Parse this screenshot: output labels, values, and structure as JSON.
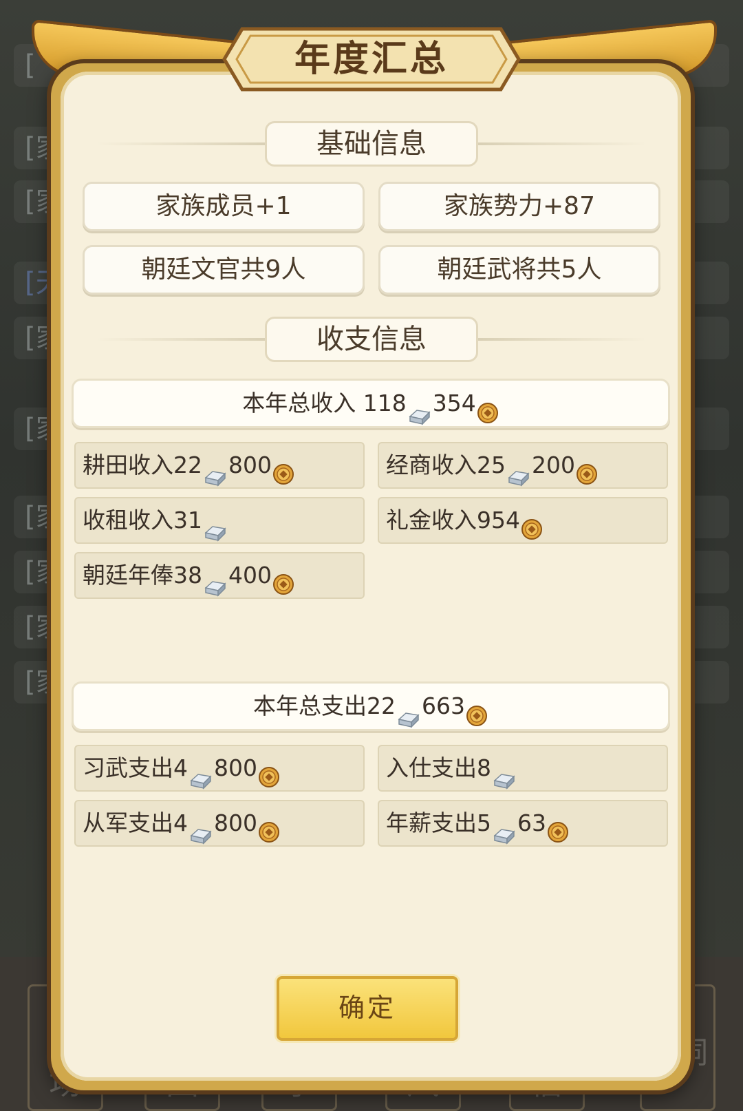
{
  "modal": {
    "title": "年度汇总",
    "sections": {
      "basic": "基础信息",
      "finance": "收支信息"
    },
    "basic_info": [
      "家族成员+1",
      "家族势力+87",
      "朝廷文官共9人",
      "朝廷武将共5人"
    ],
    "income_total": {
      "label": "本年总收入 ",
      "silver": "118",
      "copper": "354"
    },
    "income_items": [
      {
        "label": "耕田收入",
        "silver": "22",
        "copper": "800"
      },
      {
        "label": "经商收入",
        "silver": "25",
        "copper": "200"
      },
      {
        "label": "收租收入",
        "silver": "31",
        "copper": ""
      },
      {
        "label": "礼金收入",
        "silver": "",
        "copper": "954"
      },
      {
        "label": "朝廷年俸",
        "silver": "38",
        "copper": "400"
      }
    ],
    "expense_total": {
      "label": "本年总支出",
      "silver": "22",
      "copper": "663"
    },
    "expense_items": [
      {
        "label": "习武支出",
        "silver": "4",
        "copper": "800"
      },
      {
        "label": "入仕支出",
        "silver": "8",
        "copper": ""
      },
      {
        "label": "从军支出",
        "silver": "4",
        "copper": "800"
      },
      {
        "label": "年薪支出",
        "silver": "5",
        "copper": "63"
      }
    ],
    "confirm_label": "确定"
  },
  "background": {
    "rows": [
      "[",
      "[家",
      "[家",
      "[天",
      "[家",
      "[家",
      "[家",
      "[家",
      "[家",
      "[家"
    ],
    "tabs": [
      "场",
      "园",
      "事",
      "风",
      "信",
      "宗祠"
    ]
  },
  "colors": {
    "frame_gold": "#d0a84b",
    "panel": "#f7f0dc",
    "confirm": "#f1c73d"
  },
  "icons": {
    "silver": "silver-ingot-icon",
    "copper": "copper-coin-icon"
  }
}
